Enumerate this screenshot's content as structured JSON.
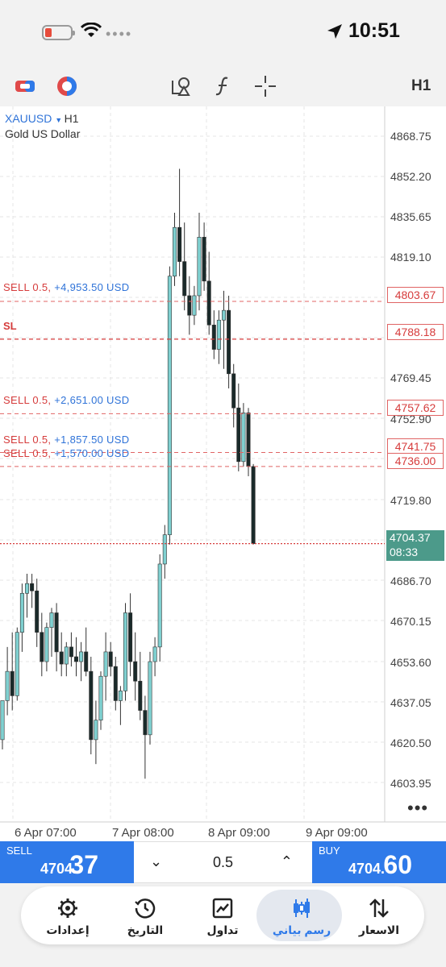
{
  "status": {
    "time": "10:51"
  },
  "toolbar": {
    "timeframe": "H1"
  },
  "chart": {
    "symbol": "XAUUSD",
    "timeframe": "H1",
    "description": "Gold US Dollar",
    "price_ticks": [
      "4868.75",
      "4852.20",
      "4835.65",
      "4819.10",
      "4769.45",
      "4752.90",
      "4719.80",
      "4686.70",
      "4670.15",
      "4653.60",
      "4637.05",
      "4620.50",
      "4603.95"
    ],
    "date_ticks": [
      "6 Apr 07:00",
      "7 Apr 08:00",
      "8 Apr 09:00",
      "9 Apr 09:00"
    ],
    "positions": [
      {
        "label": "SELL 0.5,",
        "profit": "+4,953.50 USD",
        "price": "4803.67",
        "value": 4803.67
      },
      {
        "label": "SELL 0.5,",
        "profit": "+2,651.00 USD",
        "price": "4757.62",
        "value": 4757.62
      },
      {
        "label": "SELL 0.5,",
        "profit": "+1,857.50 USD",
        "price": "4741.75",
        "value": 4741.75
      },
      {
        "label": "SELL 0.5,",
        "profit": "+1,570.00 USD",
        "price": "4736.00",
        "value": 4736.0
      }
    ],
    "stop_loss": {
      "label": "SL",
      "price": "4788.18",
      "value": 4788.18
    },
    "current": {
      "price": "4704.37",
      "countdown": "08:33",
      "value": 4704.37
    },
    "colors": {
      "up": "#7fd0d0",
      "down": "#1a2a2a",
      "sell_line": "#e06464",
      "current_line": "#d63c3c",
      "grid": "#e4e4e4"
    }
  },
  "trade": {
    "sell_caption": "SELL",
    "sell_price_main": "4704.",
    "sell_price_big": "37",
    "lot": "0.5",
    "buy_caption": "BUY",
    "buy_price_main": "4704.",
    "buy_price_big": "60"
  },
  "nav": {
    "items": [
      {
        "label": "إعدادات",
        "icon": "gear-icon"
      },
      {
        "label": "التاريخ",
        "icon": "history-icon"
      },
      {
        "label": "تداول",
        "icon": "trade-icon"
      },
      {
        "label": "رسم بياني",
        "icon": "chart-icon"
      },
      {
        "label": "الاسعار",
        "icon": "quotes-icon"
      }
    ]
  },
  "chart_data": {
    "type": "candlestick",
    "title": "XAUUSD H1",
    "ylim": [
      4595,
      4880
    ],
    "candles": [
      {
        "o": 4624,
        "h": 4640,
        "l": 4620,
        "c": 4640
      },
      {
        "o": 4640,
        "h": 4662,
        "l": 4634,
        "c": 4652
      },
      {
        "o": 4652,
        "h": 4668,
        "l": 4636,
        "c": 4642
      },
      {
        "o": 4642,
        "h": 4670,
        "l": 4640,
        "c": 4668
      },
      {
        "o": 4668,
        "h": 4688,
        "l": 4660,
        "c": 4684
      },
      {
        "o": 4684,
        "h": 4692,
        "l": 4674,
        "c": 4688
      },
      {
        "o": 4688,
        "h": 4692,
        "l": 4678,
        "c": 4685
      },
      {
        "o": 4685,
        "h": 4690,
        "l": 4662,
        "c": 4668
      },
      {
        "o": 4668,
        "h": 4676,
        "l": 4650,
        "c": 4656
      },
      {
        "o": 4656,
        "h": 4672,
        "l": 4652,
        "c": 4670
      },
      {
        "o": 4670,
        "h": 4678,
        "l": 4658,
        "c": 4676
      },
      {
        "o": 4676,
        "h": 4680,
        "l": 4652,
        "c": 4660
      },
      {
        "o": 4660,
        "h": 4668,
        "l": 4650,
        "c": 4655
      },
      {
        "o": 4655,
        "h": 4664,
        "l": 4650,
        "c": 4662
      },
      {
        "o": 4662,
        "h": 4668,
        "l": 4654,
        "c": 4658
      },
      {
        "o": 4658,
        "h": 4666,
        "l": 4650,
        "c": 4656
      },
      {
        "o": 4656,
        "h": 4664,
        "l": 4648,
        "c": 4660
      },
      {
        "o": 4660,
        "h": 4670,
        "l": 4650,
        "c": 4652
      },
      {
        "o": 4652,
        "h": 4658,
        "l": 4618,
        "c": 4624
      },
      {
        "o": 4624,
        "h": 4640,
        "l": 4614,
        "c": 4632
      },
      {
        "o": 4632,
        "h": 4652,
        "l": 4628,
        "c": 4650
      },
      {
        "o": 4650,
        "h": 4668,
        "l": 4640,
        "c": 4660
      },
      {
        "o": 4660,
        "h": 4664,
        "l": 4650,
        "c": 4654
      },
      {
        "o": 4654,
        "h": 4658,
        "l": 4636,
        "c": 4640
      },
      {
        "o": 4640,
        "h": 4646,
        "l": 4630,
        "c": 4644
      },
      {
        "o": 4644,
        "h": 4680,
        "l": 4640,
        "c": 4676
      },
      {
        "o": 4676,
        "h": 4684,
        "l": 4650,
        "c": 4656
      },
      {
        "o": 4656,
        "h": 4668,
        "l": 4640,
        "c": 4648
      },
      {
        "o": 4648,
        "h": 4660,
        "l": 4632,
        "c": 4636
      },
      {
        "o": 4636,
        "h": 4642,
        "l": 4608,
        "c": 4626
      },
      {
        "o": 4626,
        "h": 4660,
        "l": 4622,
        "c": 4656
      },
      {
        "o": 4656,
        "h": 4666,
        "l": 4650,
        "c": 4662
      },
      {
        "o": 4662,
        "h": 4700,
        "l": 4656,
        "c": 4696
      },
      {
        "o": 4696,
        "h": 4712,
        "l": 4690,
        "c": 4708
      },
      {
        "o": 4708,
        "h": 4818,
        "l": 4704,
        "c": 4814
      },
      {
        "o": 4814,
        "h": 4840,
        "l": 4810,
        "c": 4834
      },
      {
        "o": 4834,
        "h": 4858,
        "l": 4814,
        "c": 4820
      },
      {
        "o": 4820,
        "h": 4836,
        "l": 4800,
        "c": 4806
      },
      {
        "o": 4806,
        "h": 4814,
        "l": 4790,
        "c": 4798
      },
      {
        "o": 4798,
        "h": 4810,
        "l": 4794,
        "c": 4806
      },
      {
        "o": 4806,
        "h": 4840,
        "l": 4800,
        "c": 4830
      },
      {
        "o": 4830,
        "h": 4836,
        "l": 4808,
        "c": 4812
      },
      {
        "o": 4812,
        "h": 4824,
        "l": 4790,
        "c": 4794
      },
      {
        "o": 4794,
        "h": 4800,
        "l": 4780,
        "c": 4784
      },
      {
        "o": 4784,
        "h": 4800,
        "l": 4778,
        "c": 4796
      },
      {
        "o": 4796,
        "h": 4808,
        "l": 4776,
        "c": 4800
      },
      {
        "o": 4800,
        "h": 4806,
        "l": 4768,
        "c": 4774
      },
      {
        "o": 4774,
        "h": 4778,
        "l": 4752,
        "c": 4760
      },
      {
        "o": 4760,
        "h": 4770,
        "l": 4734,
        "c": 4738
      },
      {
        "o": 4738,
        "h": 4762,
        "l": 4736,
        "c": 4758
      },
      {
        "o": 4758,
        "h": 4760,
        "l": 4732,
        "c": 4736
      },
      {
        "o": 4736,
        "h": 4737,
        "l": 4704,
        "c": 4704.37
      }
    ]
  }
}
